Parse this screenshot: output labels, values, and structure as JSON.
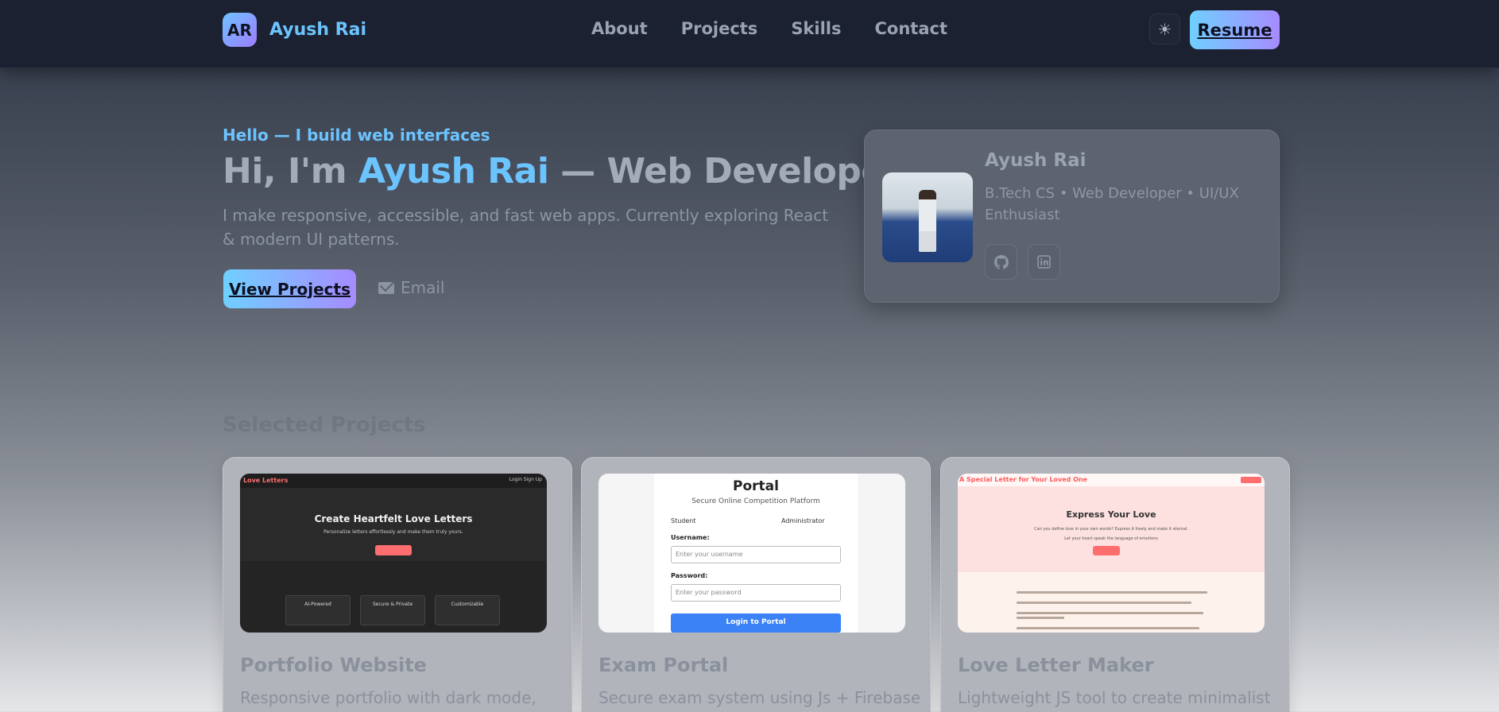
{
  "nav": {
    "logo_initials": "AR",
    "brand_name": "Ayush Rai",
    "links": [
      "About",
      "Projects",
      "Skills",
      "Contact"
    ],
    "theme_icon": "sun-icon",
    "resume_label": "Resume"
  },
  "hero": {
    "eyebrow": "Hello — I build web interfaces",
    "title_prefix": "Hi, I'm ",
    "title_name": "Ayush Rai",
    "title_suffix": " — Web Developer",
    "subtitle": "I make responsive, accessible, and fast web apps. Currently exploring React & modern UI patterns.",
    "cta_label": "View Projects",
    "email_label": "Email"
  },
  "profile": {
    "name": "Ayush Rai",
    "role": "B.Tech CS • Web Developer • UI/UX Enthusiast",
    "social_icons": [
      "github-icon",
      "linkedin-icon"
    ]
  },
  "projects": {
    "section_title": "Selected Projects",
    "items": [
      {
        "title": "Portfolio Website",
        "description": "Responsive portfolio with dark mode,",
        "thumb": {
          "brand": "Love Letters",
          "nav": "Login   Sign Up",
          "heading": "Create Heartfelt Love Letters",
          "sub": "Personalize letters effortlessly and make them truly yours.",
          "features": [
            "AI-Powered",
            "Secure & Private",
            "Customizable"
          ]
        }
      },
      {
        "title": "Exam Portal",
        "description": "Secure exam system using Js + Firebase",
        "thumb": {
          "heading": "Portal",
          "sub": "Secure Online Competition Platform",
          "role_student": "Student",
          "role_admin": "Administrator",
          "username_label": "Username:",
          "username_placeholder": "Enter your username",
          "password_label": "Password:",
          "password_placeholder": "Enter your password",
          "login_label": "Login to Portal"
        }
      },
      {
        "title": "Love Letter Maker",
        "description": "Lightweight JS tool to create minimalist",
        "thumb": {
          "brand": "A Special Letter for Your Loved One",
          "heading": "Express Your Love",
          "sub1": "Can you define love in your own words? Express it freely and make it eternal.",
          "sub2": "Let your heart speak the language of emotions"
        }
      }
    ]
  },
  "colors": {
    "accent": "#6cc4ff",
    "gradient_start": "#6fd0ff",
    "gradient_end": "#a78bff",
    "nav_bg": "#1b2130"
  }
}
